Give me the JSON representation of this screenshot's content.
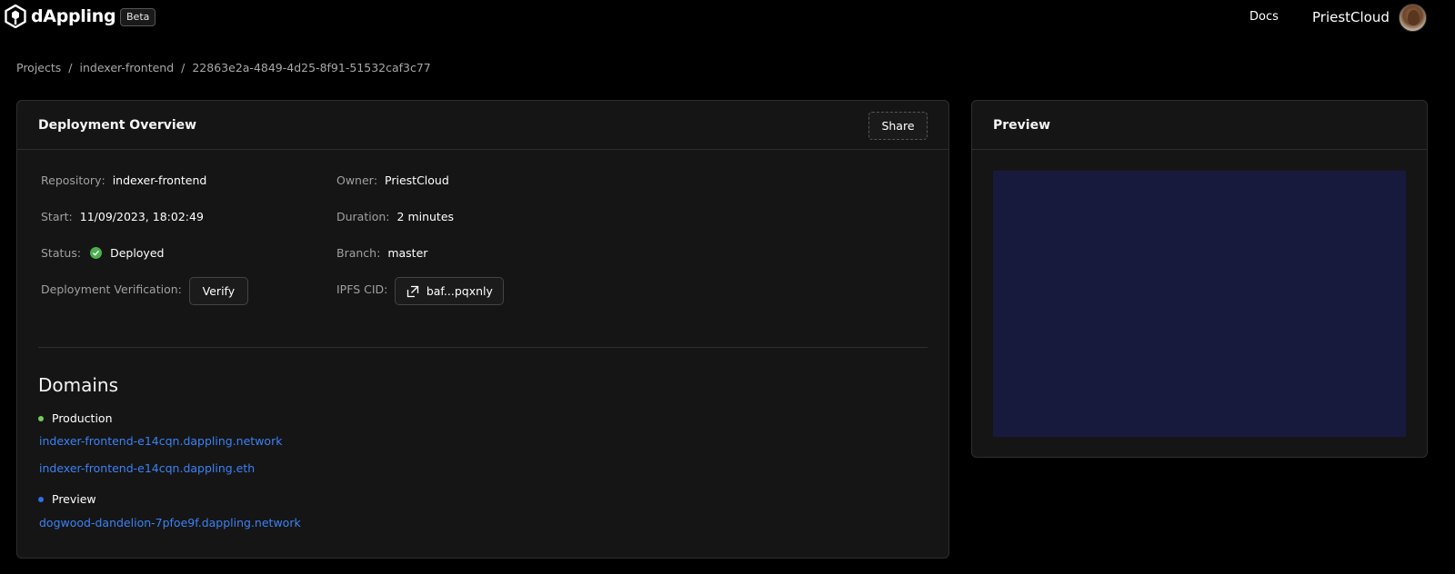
{
  "header": {
    "brand": "dAppling",
    "badge": "Beta",
    "docs_label": "Docs",
    "user_name": "PriestCloud"
  },
  "breadcrumb": {
    "items": [
      "Projects",
      "indexer-frontend",
      "22863e2a-4849-4d25-8f91-51532caf3c77"
    ],
    "separator": "/"
  },
  "overview": {
    "title": "Deployment Overview",
    "share_label": "Share",
    "fields": {
      "repository": {
        "label": "Repository",
        "value": "indexer-frontend"
      },
      "owner": {
        "label": "Owner",
        "value": "PriestCloud"
      },
      "start": {
        "label": "Start",
        "value": "11/09/2023, 18:02:49"
      },
      "duration": {
        "label": "Duration",
        "value": "2 minutes"
      },
      "status": {
        "label": "Status",
        "value": "Deployed"
      },
      "branch": {
        "label": "Branch",
        "value": "master"
      },
      "verification": {
        "label": "Deployment Verification",
        "button": "Verify"
      },
      "ipfs": {
        "label": "IPFS CID",
        "button": "baf...pqxnly"
      }
    },
    "colon": ":"
  },
  "domains": {
    "title": "Domains",
    "production": {
      "label": "Production",
      "links": [
        "indexer-frontend-e14cqn.dappling.network",
        "indexer-frontend-e14cqn.dappling.eth"
      ]
    },
    "preview": {
      "label": "Preview",
      "links": [
        "dogwood-dandelion-7pfoe9f.dappling.network"
      ]
    }
  },
  "preview_panel": {
    "title": "Preview"
  },
  "colors": {
    "background": "#000000",
    "card": "#151515",
    "link": "#3b82f6",
    "production_dot": "#6fcf5a",
    "preview_dot": "#2f6fe0",
    "status_ok": "#4caf50",
    "preview_frame": "#181a3d"
  }
}
